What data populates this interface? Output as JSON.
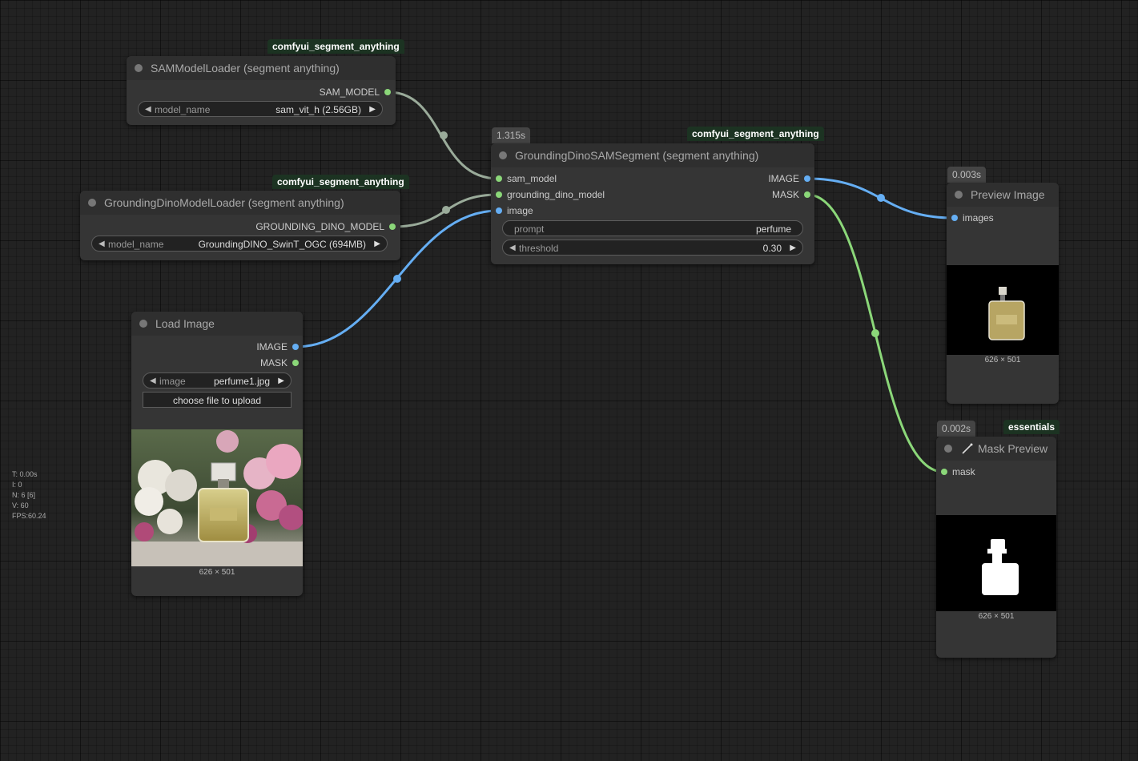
{
  "stats": {
    "t": "T: 0.00s",
    "i": "I: 0",
    "n": "N: 6 [6]",
    "v": "V: 60",
    "fps": "FPS:60.24"
  },
  "colors": {
    "image_link": "#65aef3",
    "mask_link": "#8bd779",
    "model_link": "#9aab9a",
    "badge_bg": "#1c3322"
  },
  "nodes": {
    "sam_loader": {
      "badge": "comfyui_segment_anything",
      "title": "SAMModelLoader (segment anything)",
      "output": "SAM_MODEL",
      "widget_name": "model_name",
      "widget_value": "sam_vit_h (2.56GB)"
    },
    "dino_loader": {
      "badge": "comfyui_segment_anything",
      "title": "GroundingDinoModelLoader (segment anything)",
      "output": "GROUNDING_DINO_MODEL",
      "widget_name": "model_name",
      "widget_value": "GroundingDINO_SwinT_OGC (694MB)"
    },
    "load_image": {
      "title": "Load Image",
      "outputs": [
        "IMAGE",
        "MASK"
      ],
      "widget_name": "image",
      "widget_value": "perfume1.jpg",
      "upload_label": "choose file to upload",
      "image_size": "626 × 501"
    },
    "segment": {
      "timer": "1.315s",
      "badge": "comfyui_segment_anything",
      "title": "GroundingDinoSAMSegment (segment anything)",
      "inputs": [
        "sam_model",
        "grounding_dino_model",
        "image"
      ],
      "outputs": [
        "IMAGE",
        "MASK"
      ],
      "prompt_name": "prompt",
      "prompt_value": "perfume",
      "threshold_name": "threshold",
      "threshold_value": "0.30"
    },
    "preview": {
      "timer": "0.003s",
      "title": "Preview Image",
      "input": "images",
      "image_size": "626 × 501"
    },
    "mask_preview": {
      "timer": "0.002s",
      "badge": "essentials",
      "title": "Mask Preview",
      "input": "mask",
      "image_size": "626 × 501"
    }
  }
}
